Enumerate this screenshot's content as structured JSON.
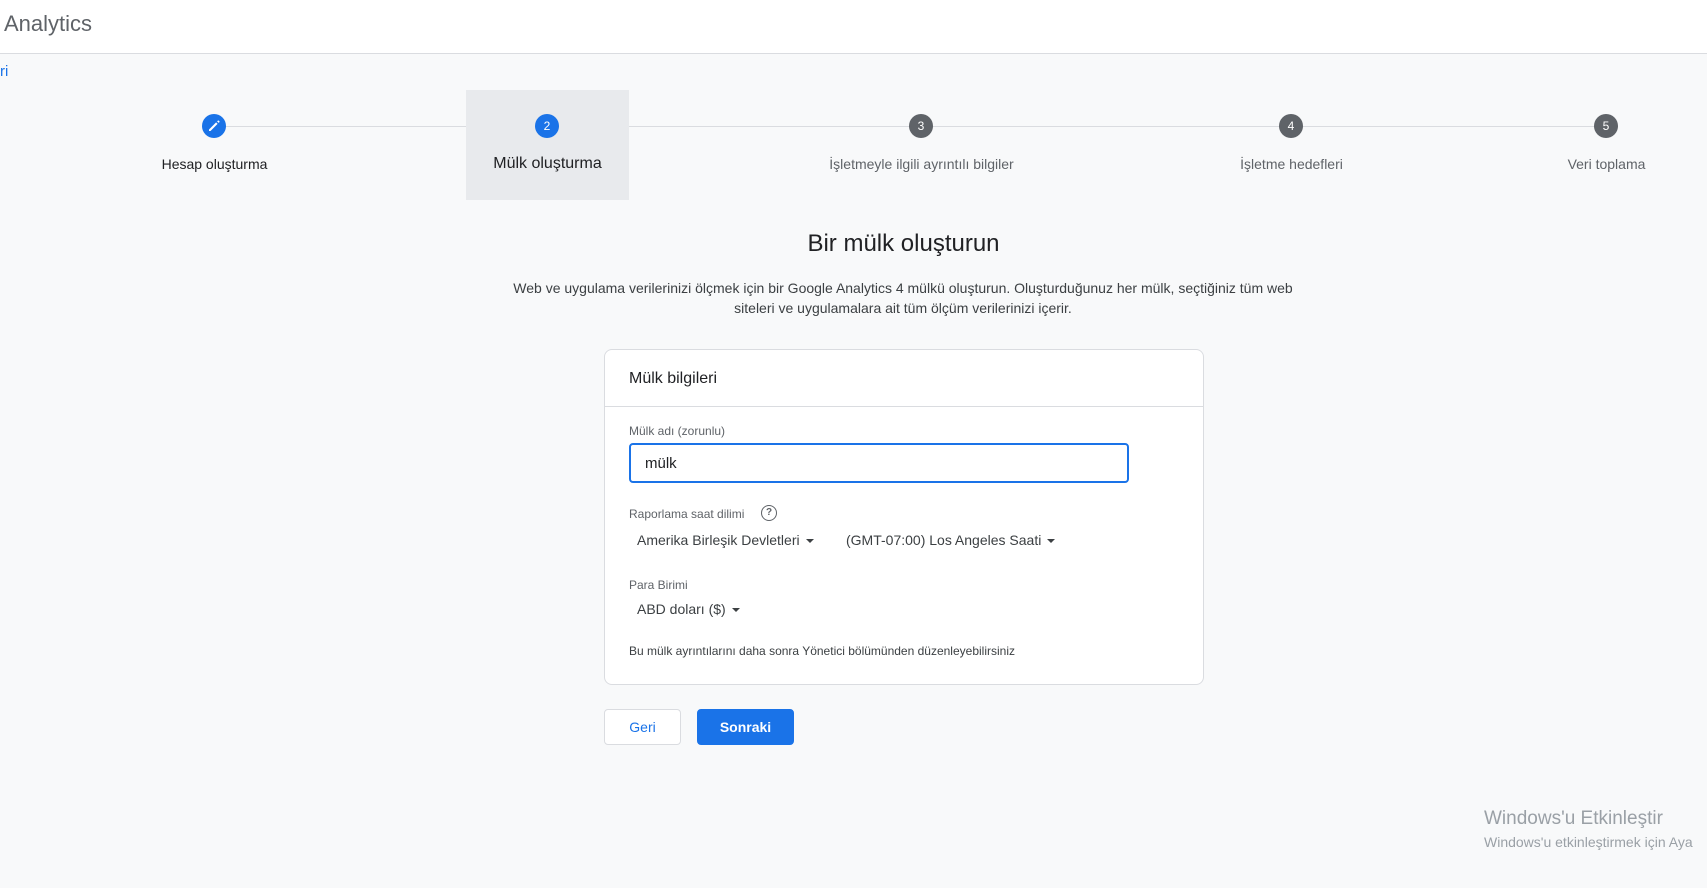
{
  "header": {
    "app_title": "Analytics"
  },
  "nav": {
    "back_link": "ri"
  },
  "stepper": {
    "steps": [
      {
        "number": "",
        "label": "Hesap oluşturma",
        "state": "done",
        "icon": "pencil-icon"
      },
      {
        "number": "2",
        "label": "Mülk oluşturma",
        "state": "active"
      },
      {
        "number": "3",
        "label": "İşletmeyle ilgili ayrıntılı bilgiler",
        "state": "pending"
      },
      {
        "number": "4",
        "label": "İşletme hedefleri",
        "state": "pending"
      },
      {
        "number": "5",
        "label": "Veri toplama",
        "state": "pending"
      }
    ]
  },
  "main": {
    "title": "Bir mülk oluşturun",
    "description": "Web ve uygulama verilerinizi ölçmek için bir Google Analytics 4 mülkü oluşturun. Oluşturduğunuz her mülk, seçtiğiniz tüm web siteleri ve uygulamalara ait tüm ölçüm verilerinizi içerir."
  },
  "card": {
    "header": "Mülk bilgileri",
    "property_name": {
      "label": "Mülk adı (zorunlu)",
      "value": "mülk"
    },
    "timezone": {
      "label": "Raporlama saat dilimi",
      "help_icon": "help-circle-icon",
      "country": "Amerika Birleşik Devletleri",
      "zone": "(GMT-07:00) Los Angeles Saati"
    },
    "currency": {
      "label": "Para Birimi",
      "value": "ABD doları ($)"
    },
    "hint": "Bu mülk ayrıntılarını daha sonra Yönetici bölümünden düzenleyebilirsiniz"
  },
  "buttons": {
    "back": "Geri",
    "next": "Sonraki"
  },
  "watermark": {
    "title": "Windows'u Etkinleştir",
    "subtitle": "Windows'u etkinleştirmek için Aya"
  },
  "colors": {
    "accent": "#1a73e8",
    "pending_step": "#5f6368",
    "active_step_bg": "#e8eaed"
  }
}
